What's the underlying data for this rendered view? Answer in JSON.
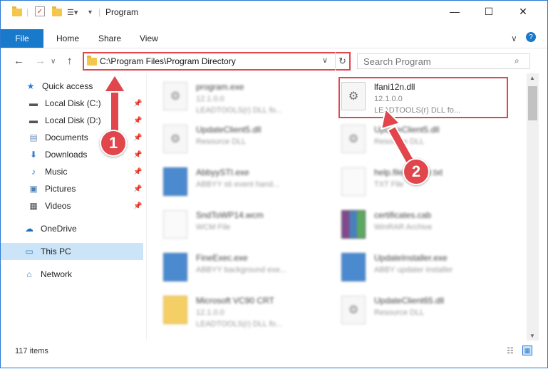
{
  "window": {
    "title": "Program"
  },
  "ribbon": {
    "tabs": [
      "File",
      "Home",
      "Share",
      "View"
    ]
  },
  "address": {
    "path": "C:\\Program Files\\Program Directory"
  },
  "search": {
    "placeholder": "Search Program"
  },
  "sidebar": {
    "items": [
      {
        "label": "Quick access",
        "icon": "star-icon"
      },
      {
        "label": "Local Disk (C:)",
        "icon": "drive-icon",
        "pinned": true
      },
      {
        "label": "Local Disk (D:)",
        "icon": "drive-icon",
        "pinned": true
      },
      {
        "label": "Documents",
        "icon": "documents-icon",
        "pinned": true
      },
      {
        "label": "Downloads",
        "icon": "downloads-icon",
        "pinned": true
      },
      {
        "label": "Music",
        "icon": "music-icon",
        "pinned": true
      },
      {
        "label": "Pictures",
        "icon": "pictures-icon",
        "pinned": true
      },
      {
        "label": "Videos",
        "icon": "videos-icon",
        "pinned": true
      },
      {
        "label": "OneDrive",
        "icon": "cloud-icon"
      },
      {
        "label": "This PC",
        "icon": "computer-icon",
        "selected": true
      },
      {
        "label": "Network",
        "icon": "network-icon"
      }
    ]
  },
  "files": {
    "left": [
      {
        "name": "program.exe",
        "line1": "12.1.0.0",
        "line2": "LEADTOOLS(r) DLL fo..."
      },
      {
        "name": "UpdateClient5.dll",
        "line1": "Resource DLL",
        "line2": ""
      },
      {
        "name": "AbbyySTI.exe",
        "line1": "ABBYY sti event hand...",
        "line2": ""
      },
      {
        "name": "SndToWP14.wcm",
        "line1": "WCM File",
        "line2": ""
      },
      {
        "name": "FineExec.exe",
        "line1": "ABBYY background exe...",
        "line2": ""
      },
      {
        "name": "Microsoft VC90 CRT",
        "line1": "12.1.0.0",
        "line2": "LEADTOOLS(r) DLL fo..."
      }
    ],
    "right": [
      {
        "name": "lfani12n.dll",
        "line1": "12.1.0.0",
        "line2": "LEADTOOLS(r) DLL fo..."
      },
      {
        "name": "UpdateClient5.dll",
        "line1": "Resource DLL",
        "line2": ""
      },
      {
        "name": "help.files.folder.txt",
        "line1": "TXT File",
        "line2": ""
      },
      {
        "name": "certificates.cab",
        "line1": "WinRAR Archive",
        "line2": ""
      },
      {
        "name": "UpdateInstaller.exe",
        "line1": "ABBY updater installer",
        "line2": ""
      },
      {
        "name": "UpdateClient65.dll",
        "line1": "Resource DLL",
        "line2": ""
      }
    ]
  },
  "status": {
    "count": "117 items"
  },
  "markers": [
    "1",
    "2"
  ],
  "colors": {
    "accent": "#1979ca",
    "annotation": "#e0464b",
    "selected": "#cce4f7"
  }
}
